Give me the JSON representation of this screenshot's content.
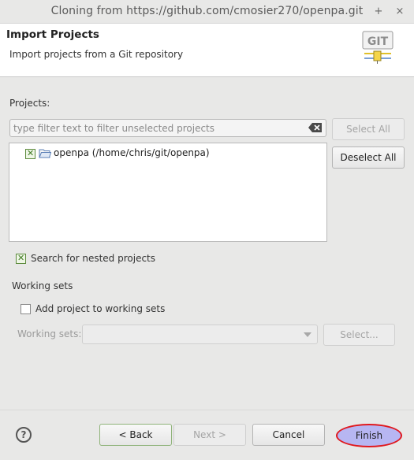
{
  "window": {
    "title": "Cloning from https://github.com/cmosier270/openpa.git",
    "close_glyph": "×",
    "menu_glyph": "+"
  },
  "header": {
    "title": "Import Projects",
    "subtitle": "Import projects from a Git repository",
    "logo_text": "GIT"
  },
  "projects": {
    "label": "Projects:",
    "filter_placeholder": "type filter text to filter unselected projects",
    "select_all": "Select All",
    "deselect_all": "Deselect All",
    "items": [
      {
        "label": "openpa (/home/chris/git/openpa)",
        "checked": true
      }
    ]
  },
  "nested": {
    "label": "Search for nested projects",
    "checked": true
  },
  "working_sets": {
    "heading": "Working sets",
    "add_label": "Add project to working sets",
    "add_checked": false,
    "field_label": "Working sets:",
    "select_button": "Select..."
  },
  "footer": {
    "help": "?",
    "back": "< Back",
    "next": "Next >",
    "cancel": "Cancel",
    "finish": "Finish"
  },
  "colors": {
    "finish_highlight": "#e0191e",
    "finish_fill": "#b7b6f2"
  }
}
